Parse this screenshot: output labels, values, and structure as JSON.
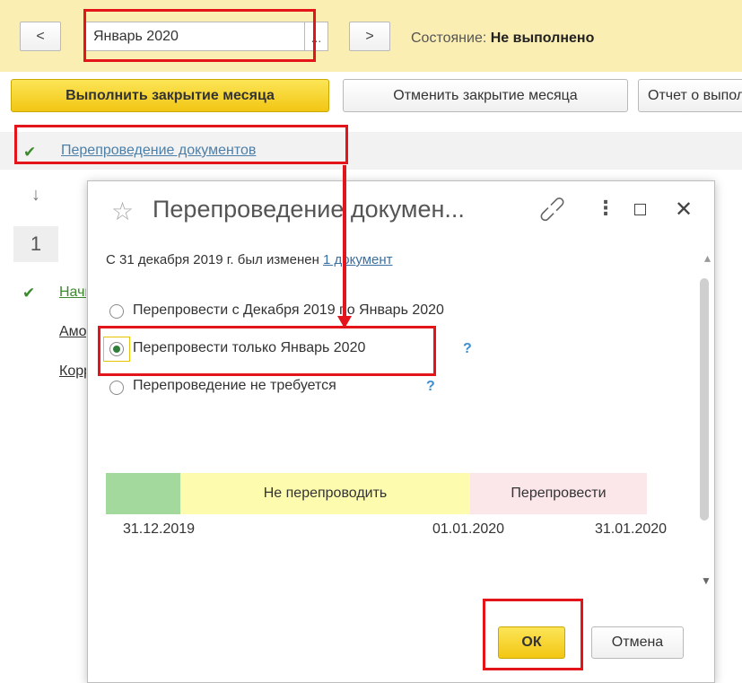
{
  "toolbar": {
    "prev_label": "<",
    "next_label": ">",
    "period_value": "Январь 2020",
    "period_picker": "...",
    "state_label": "Состояние:",
    "state_value": "Не выполнено"
  },
  "actions": {
    "close_month": "Выполнить закрытие месяца",
    "cancel_close": "Отменить закрытие месяца",
    "report": "Отчет о выполнении"
  },
  "section": {
    "title": "Перепроведение документов"
  },
  "background": {
    "step_number": "1",
    "items": [
      "Начисление",
      "Амортизация",
      "Корректировка"
    ]
  },
  "dialog": {
    "title": "Перепроведение докумен...",
    "info_prefix": "С 31 декабря 2019 г. был изменен",
    "info_link": "1 документ",
    "options": [
      "Перепровести с Декабря 2019 по Январь 2020",
      "Перепровести только Январь 2020",
      "Перепроведение не требуется"
    ],
    "selected_option_index": 1,
    "help_mark": "?",
    "timeline": {
      "segments": [
        {
          "label": "",
          "color": "#a3d99c"
        },
        {
          "label": "Не перепроводить",
          "color": "#fdfcae"
        },
        {
          "label": "Перепровести",
          "color": "#fbe6ea"
        }
      ],
      "dates": [
        "31.12.2019",
        "01.01.2020",
        "31.01.2020"
      ]
    },
    "ok_label": "ОК",
    "cancel_label": "Отмена"
  },
  "colors": {
    "accent_yellow": "#f2c613",
    "annotation_red": "#e3141a",
    "topbar_bg": "#fbeeb3"
  }
}
